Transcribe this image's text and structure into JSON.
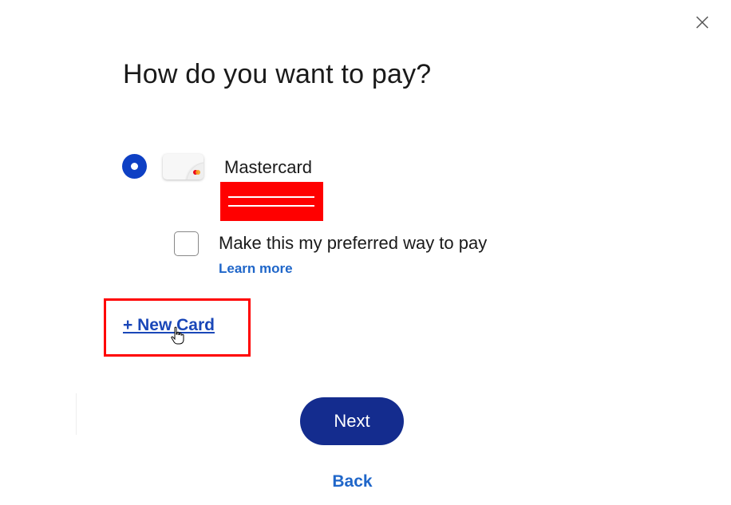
{
  "dialog": {
    "title": "How do you want to pay?",
    "close_icon": "close-icon"
  },
  "payment_method": {
    "selected": true,
    "card_brand": "Mastercard",
    "card_icon": "mastercard-card-icon",
    "card_number_redacted": true
  },
  "preferred": {
    "checked": false,
    "label": "Make this my preferred way to pay",
    "learn_more": "Learn more"
  },
  "add_card": {
    "label": "+ New Card"
  },
  "actions": {
    "next_label": "Next",
    "back_label": "Back"
  },
  "colors": {
    "primary_button": "#142c8e",
    "radio": "#0e40c4",
    "link": "#1f66c9",
    "new_card_link": "#1a47b8",
    "annotation_red": "#ff0000"
  }
}
